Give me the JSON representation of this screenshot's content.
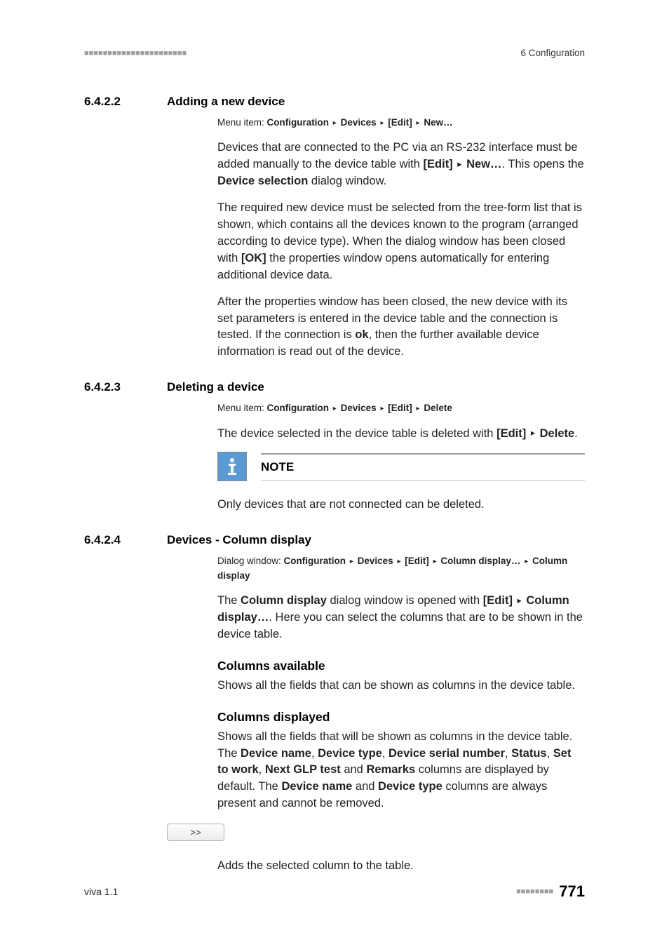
{
  "header": {
    "right": "6 Configuration"
  },
  "s1": {
    "num": "6.4.2.2",
    "title": "Adding a new device",
    "menu": {
      "label": "Menu item: ",
      "path": [
        "Configuration",
        "Devices",
        "[Edit]",
        "New…"
      ]
    },
    "p1a": "Devices that are connected to the PC via an RS-232 interface must be added manually to the device table with ",
    "p1b": "[Edit]",
    "p1c": "New…",
    "p1d": ". This opens the ",
    "p1e": "Device selection",
    "p1f": " dialog window.",
    "p2a": "The required new device must be selected from the tree-form list that is shown, which contains all the devices known to the program (arranged according to device type). When the dialog window has been closed with ",
    "p2b": "[OK]",
    "p2c": " the properties window opens automatically for entering additional device data.",
    "p3a": "After the properties window has been closed, the new device with its set parameters is entered in the device table and the connection is tested. If the connection is ",
    "p3b": "ok",
    "p3c": ", then the further available device information is read out of the device."
  },
  "s2": {
    "num": "6.4.2.3",
    "title": "Deleting a device",
    "menu": {
      "label": "Menu item: ",
      "path": [
        "Configuration",
        "Devices",
        "[Edit]",
        "Delete"
      ]
    },
    "p1a": "The device selected in the device table is deleted with ",
    "p1b": "[Edit]",
    "p1c": "Delete",
    "p1d": ".",
    "note_label": "NOTE",
    "note_body": "Only devices that are not connected can be deleted."
  },
  "s3": {
    "num": "6.4.2.4",
    "title": "Devices - Column display",
    "menu": {
      "label": "Dialog window: ",
      "path": [
        "Configuration",
        "Devices",
        "[Edit]",
        "Column display…",
        "Column display"
      ]
    },
    "p1a": "The ",
    "p1b": "Column display",
    "p1c": " dialog window is opened with ",
    "p1d": "[Edit]",
    "p1e": "Column display…",
    "p1f": ". Here you can select the columns that are to be shown in the device table.",
    "h1": "Columns available",
    "p2": "Shows all the fields that can be shown as columns in the device table.",
    "h2": "Columns displayed",
    "p3a": "Shows all the fields that will be shown as columns in the device table. The ",
    "p3b": "Device name",
    "p3c": ", ",
    "p3d": "Device type",
    "p3e": ", ",
    "p3f": "Device serial number",
    "p3g": ", ",
    "p3h": "Status",
    "p3i": ", ",
    "p3j": "Set to work",
    "p3k": ", ",
    "p3l": "Next GLP test",
    "p3m": " and ",
    "p3n": "Remarks",
    "p3o": " columns are displayed by default. The ",
    "p3p": "Device name",
    "p3q": " and ",
    "p3r": "Device type",
    "p3s": " columns are always present and cannot be removed.",
    "btn": ">>",
    "p4": "Adds the selected column to the table."
  },
  "footer": {
    "left": "viva 1.1",
    "page": "771"
  }
}
